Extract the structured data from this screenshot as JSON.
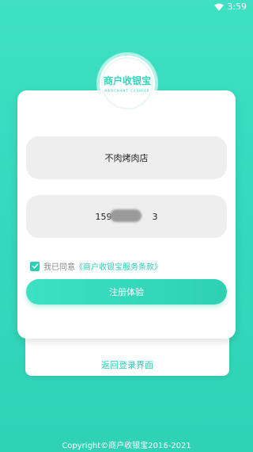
{
  "status_bar": {
    "time": "3:59",
    "wifi_icon": "wifi-icon"
  },
  "logo": {
    "text_cn": "商户收银宝",
    "text_en": "MERCHANT CASHIER"
  },
  "form": {
    "shop_name_value": "不肉烤肉店",
    "phone_value_visible_start": "1597",
    "phone_value_visible_end": "3",
    "agreement_prefix": "我已同意",
    "agreement_link": "《商户收银宝服务条款》",
    "agreement_checked": true,
    "submit_label": "注册体验"
  },
  "back_link": "返回登录界面",
  "footer": {
    "copyright": "Copyright©商户收银宝2016-2021"
  },
  "colors": {
    "accent": "#2fcdb2",
    "background": "#36d9bd"
  }
}
